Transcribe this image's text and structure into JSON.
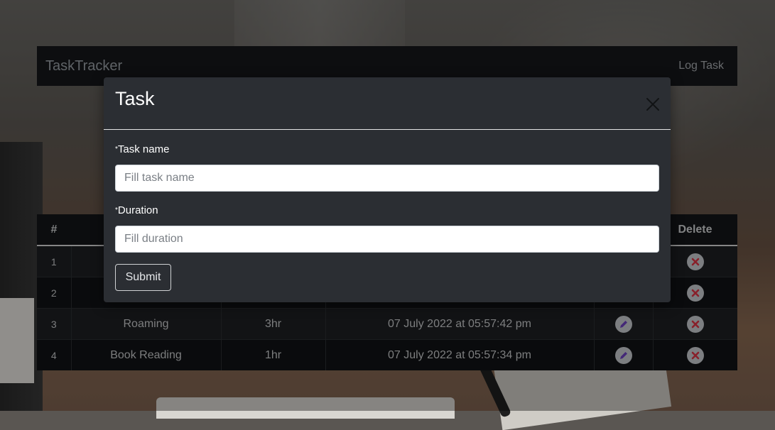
{
  "navbar": {
    "brand": "TaskTracker",
    "log_task": "Log Task"
  },
  "table": {
    "columns": [
      "#",
      "",
      "",
      "",
      "",
      "Delete"
    ],
    "rows": [
      {
        "index": "1",
        "name": "",
        "duration": "",
        "timestamp": ""
      },
      {
        "index": "2",
        "name": "",
        "duration": "",
        "timestamp": ""
      },
      {
        "index": "3",
        "name": "Roaming",
        "duration": "3hr",
        "timestamp": "07 July 2022 at 05:57:42 pm"
      },
      {
        "index": "4",
        "name": "Book Reading",
        "duration": "1hr",
        "timestamp": "07 July 2022 at 05:57:34 pm"
      }
    ]
  },
  "modal": {
    "title": "Task",
    "fields": [
      {
        "label": "Task name",
        "required_mark": "*",
        "placeholder": "Fill task name",
        "value": ""
      },
      {
        "label": "Duration",
        "required_mark": "*",
        "placeholder": "Fill duration",
        "value": ""
      }
    ],
    "submit_label": "Submit"
  },
  "icons": {
    "edit": "pencil-icon",
    "delete": "x-circle-icon",
    "close": "close-icon"
  },
  "colors": {
    "edit_icon": "#6f42c1",
    "delete_icon": "#dc3545",
    "navbar_bg": "#16181b",
    "modal_bg": "#2b2e33"
  }
}
